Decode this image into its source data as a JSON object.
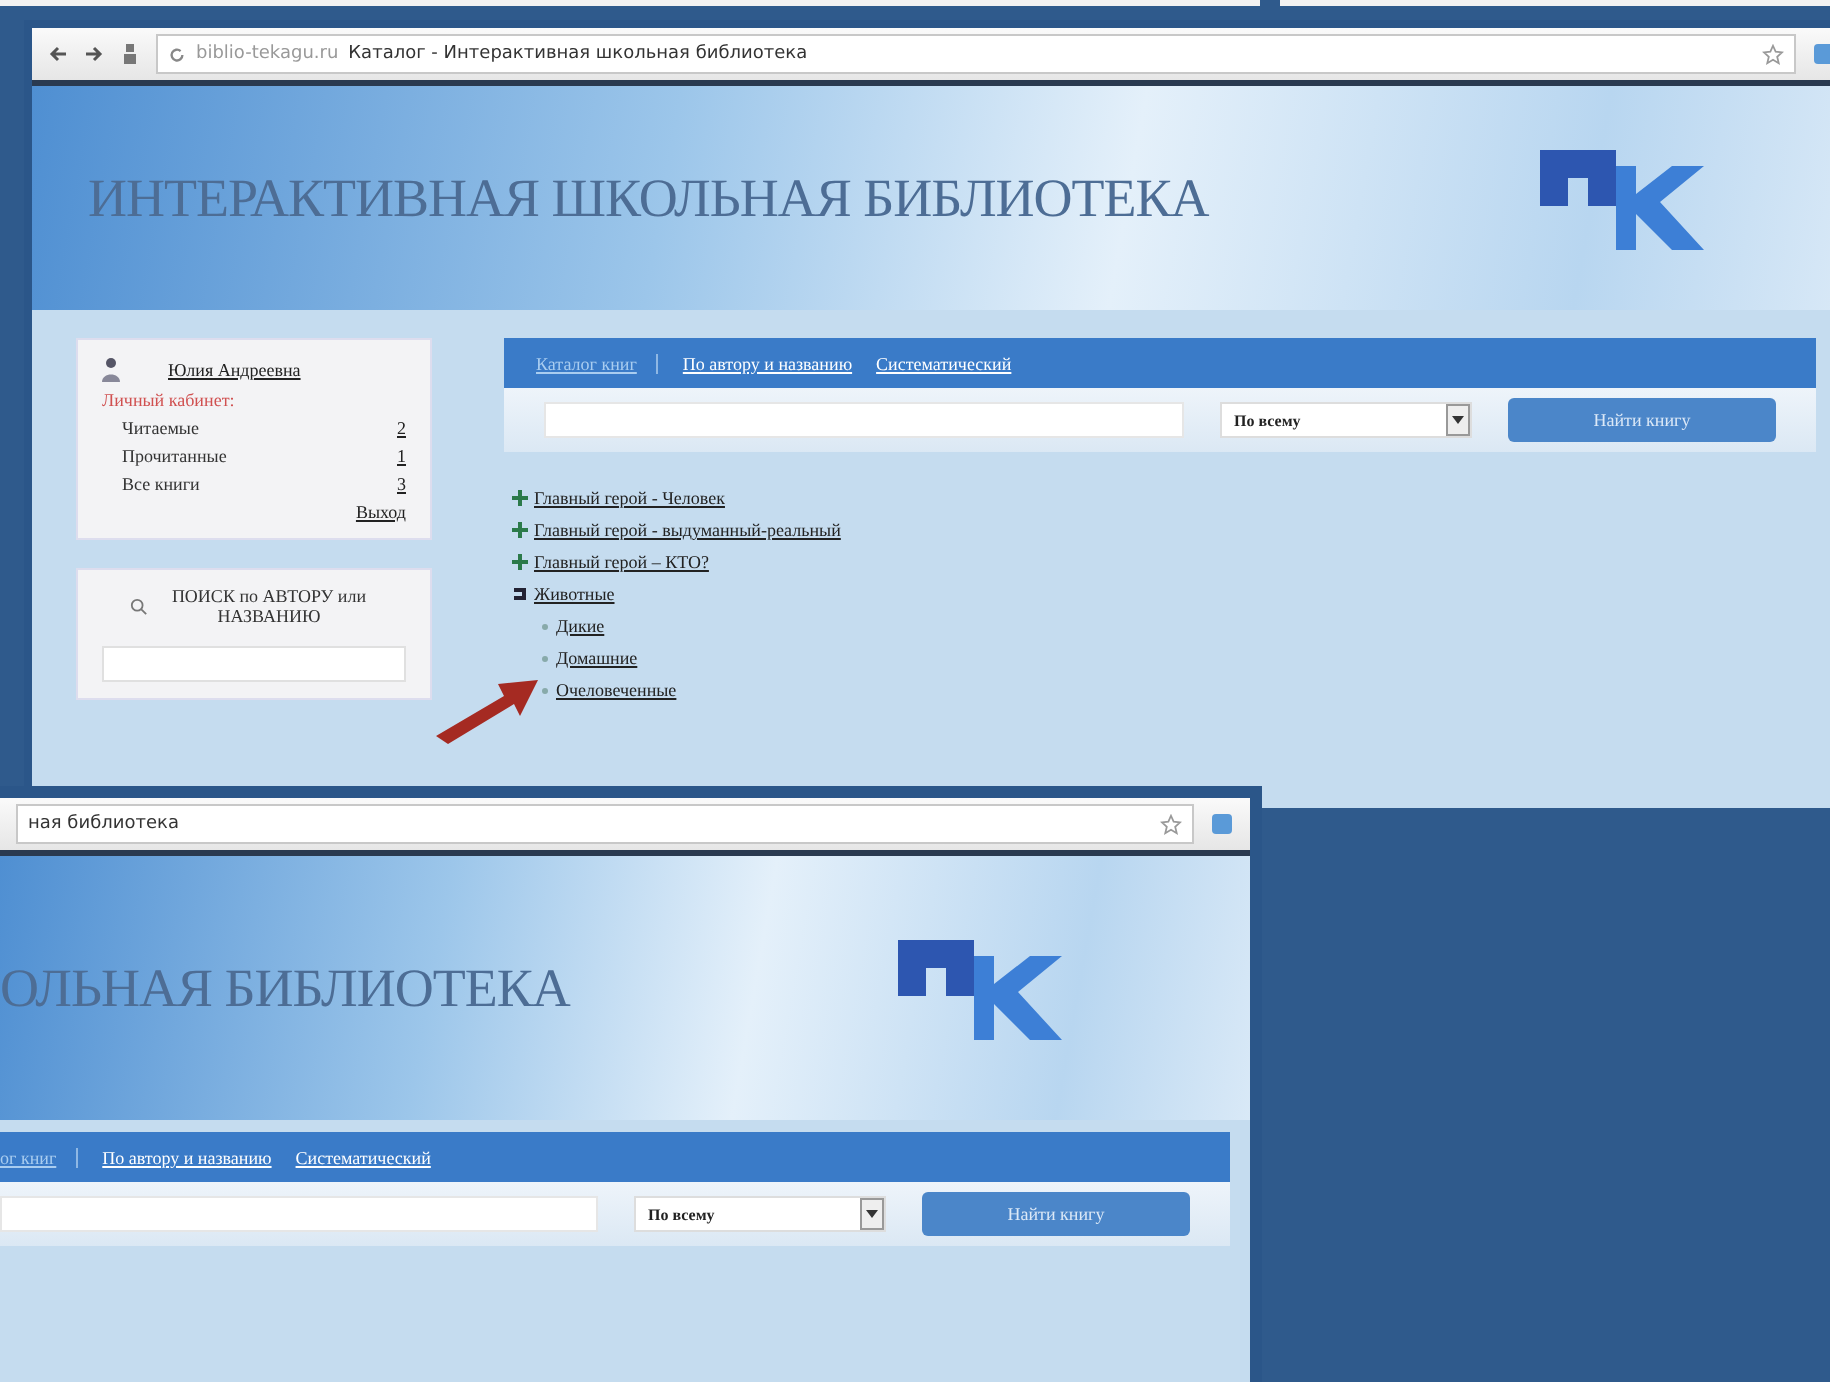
{
  "windows": [
    {
      "kind": "full",
      "address": "biblio-tekagu.ru",
      "page_title": "Каталог - Интерактивная школьная библиотека",
      "header_title": "ИНТЕРАКТИВНАЯ ШКОЛЬНАЯ БИБЛИОТЕКА",
      "user": {
        "name": "Юлия Андреевна",
        "cabinet": "Личный кабинет:",
        "stats": [
          {
            "label": "Читаемые",
            "count": "2"
          },
          {
            "label": "Прочитанные",
            "count": "1"
          },
          {
            "label": "Все книги",
            "count": "3"
          }
        ],
        "logout": "Выход"
      },
      "author_search": {
        "title": "ПОИСК по АВТОРУ или НАЗВАНИЮ"
      },
      "nav_links": [
        {
          "label": "Каталог книг",
          "selected": true
        },
        {
          "label": "По автору и названию",
          "selected": false
        },
        {
          "label": "Систематический",
          "selected": false
        }
      ],
      "search": {
        "select": "По всему",
        "button": "Найти книгу"
      },
      "tree": [
        {
          "label": "Главный герой - Человек",
          "expanded": false
        },
        {
          "label": "Главный герой - выдуманный-реальный",
          "expanded": false
        },
        {
          "label": "Главный герой – КТО?",
          "expanded": false
        },
        {
          "label": "Животные",
          "expanded": true,
          "children": [
            {
              "label": "Дикие"
            },
            {
              "label": "Домашние"
            },
            {
              "label": "Очеловеченные"
            }
          ]
        }
      ]
    },
    {
      "kind": "cropped",
      "page_title": "ная библиотека",
      "header_title": "ОЛЬНАЯ БИБЛИОТЕКА",
      "nav_links": [
        {
          "label": "ог книг",
          "selected": true
        },
        {
          "label": "По автору и названию",
          "selected": false
        },
        {
          "label": "Систематический",
          "selected": false
        }
      ],
      "search": {
        "select": "По всему",
        "button": "Найти книгу"
      }
    }
  ]
}
